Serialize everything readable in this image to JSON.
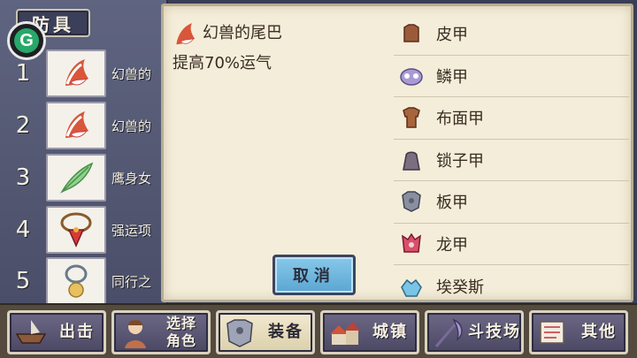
{
  "panel": {
    "tab_label": "防具",
    "badge_letter": "G"
  },
  "equipment": [
    {
      "num": "1",
      "name": "幻兽的",
      "icon": "fox-tail-icon"
    },
    {
      "num": "2",
      "name": "幻兽的",
      "icon": "fox-tail-icon"
    },
    {
      "num": "3",
      "name": "鹰身女",
      "icon": "feather-icon"
    },
    {
      "num": "4",
      "name": "强运项",
      "icon": "red-pendant-icon"
    },
    {
      "num": "5",
      "name": "同行之",
      "icon": "bell-ring-icon"
    }
  ],
  "detail": {
    "title": "幻兽的尾巴",
    "description": "提高70%运气",
    "cancel_label": "取消"
  },
  "categories": [
    {
      "label": "皮甲",
      "icon": "leather-armor-icon",
      "color": "#9b5a3a"
    },
    {
      "label": "鳞甲",
      "icon": "scale-armor-icon",
      "color": "#8f7fc0"
    },
    {
      "label": "布面甲",
      "icon": "cloth-armor-icon",
      "color": "#a8643c"
    },
    {
      "label": "锁子甲",
      "icon": "chainmail-icon",
      "color": "#7a6f80"
    },
    {
      "label": "板甲",
      "icon": "plate-armor-icon",
      "color": "#6f7588"
    },
    {
      "label": "龙甲",
      "icon": "dragon-armor-icon",
      "color": "#d8506a"
    },
    {
      "label": "埃癸斯",
      "icon": "aegis-icon",
      "color": "#5aa6d2"
    }
  ],
  "nav": [
    {
      "label": "出击",
      "icon": "boat-icon",
      "active": false
    },
    {
      "label": "选择角色",
      "line1": "选择",
      "line2": "角色",
      "icon": "character-icon",
      "active": false
    },
    {
      "label": "装备",
      "icon": "armor-icon",
      "active": true
    },
    {
      "label": "城镇",
      "icon": "town-icon",
      "active": false
    },
    {
      "label": "斗技场",
      "icon": "scythe-icon",
      "active": false
    },
    {
      "label": "其他",
      "icon": "scroll-icon",
      "active": false
    }
  ]
}
